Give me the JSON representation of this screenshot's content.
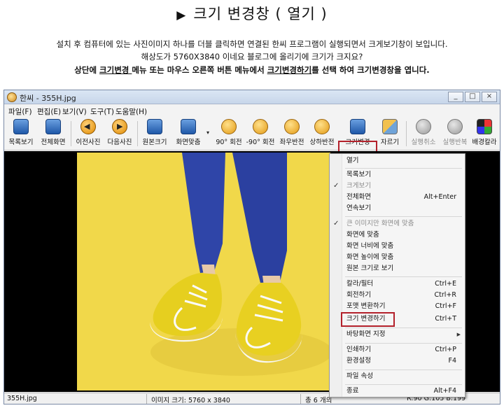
{
  "heading": {
    "marker": "▶",
    "text": "크기 변경창 ( 열기 )"
  },
  "description": {
    "line1": "설치 후 컴퓨터에 있는 사진이미지 하나를 더블 클릭하면 연결된 한씨 프로그램이 실행되면서 크게보기창이 보입니다.",
    "line2": "해상도가 5760X3840 이네요 블로그에 올리기에 크기가 크지요?",
    "line3_a": "상단에 ",
    "line3_b": "크기변경 ",
    "line3_c": "메뉴 또는 마우스 오른쪽 버튼 메뉴에서 ",
    "line3_d": "크기변경하기",
    "line3_e": "를 선택 하여 크기변경창을 엽니다."
  },
  "window": {
    "title": "한씨 - 355H.jpg",
    "min": "_",
    "max": "□",
    "close": "×"
  },
  "menubar": [
    "파일(F)",
    "편집(E)",
    "보기(V)",
    "도구(T)",
    "도움말(H)"
  ],
  "toolbar": {
    "fullview": "목록보기",
    "fullscreen": "전체화면",
    "prev": "이전사진",
    "next": "다음사진",
    "original": "원본크기",
    "fit": "화면맞춤",
    "rot_cw": "90° 회전",
    "rot_ccw": "-90° 회전",
    "flip_h": "좌우반전",
    "flip_v": "상하반전",
    "resize": "크기변경",
    "crop": "자르기",
    "undo": "실행취소",
    "redo": "실행반복",
    "bgcolor": "배경칼라",
    "dropdown": "▾"
  },
  "status": {
    "filename": "355H.jpg",
    "imagesize": "이미지 크기: 5760 x 3840",
    "count": "총 6 개의",
    "color": "R:90 G:105 B:199"
  },
  "context_menu": {
    "open": "열기",
    "list": "목록보기",
    "big": "크게보기",
    "fullscreen": "전체화면",
    "fullscreen_key": "Alt+Enter",
    "slideshow": "연속보기",
    "fit_large": "큰 이미지만 화면에 맞춤",
    "fit_screen": "화면에 맞춤",
    "fit_width": "화면 너비에 맞춤",
    "fit_height": "화면 높이에 맞춤",
    "original": "원본 크기로 보기",
    "color_filter": "칼라/필터",
    "color_filter_key": "Ctrl+E",
    "rotate": "회전하기",
    "rotate_key": "Ctrl+R",
    "format": "포맷 변환하기",
    "format_key": "Ctrl+F",
    "resize": "크기 변경하기",
    "resize_key": "Ctrl+T",
    "wallpaper": "바탕화면 지정",
    "print": "인쇄하기",
    "print_key": "Ctrl+P",
    "settings": "환경설정",
    "settings_key": "F4",
    "properties": "파일 속성",
    "exit": "종료",
    "exit_key": "Alt+F4",
    "check": "✓",
    "submenu_arrow": "▶"
  }
}
